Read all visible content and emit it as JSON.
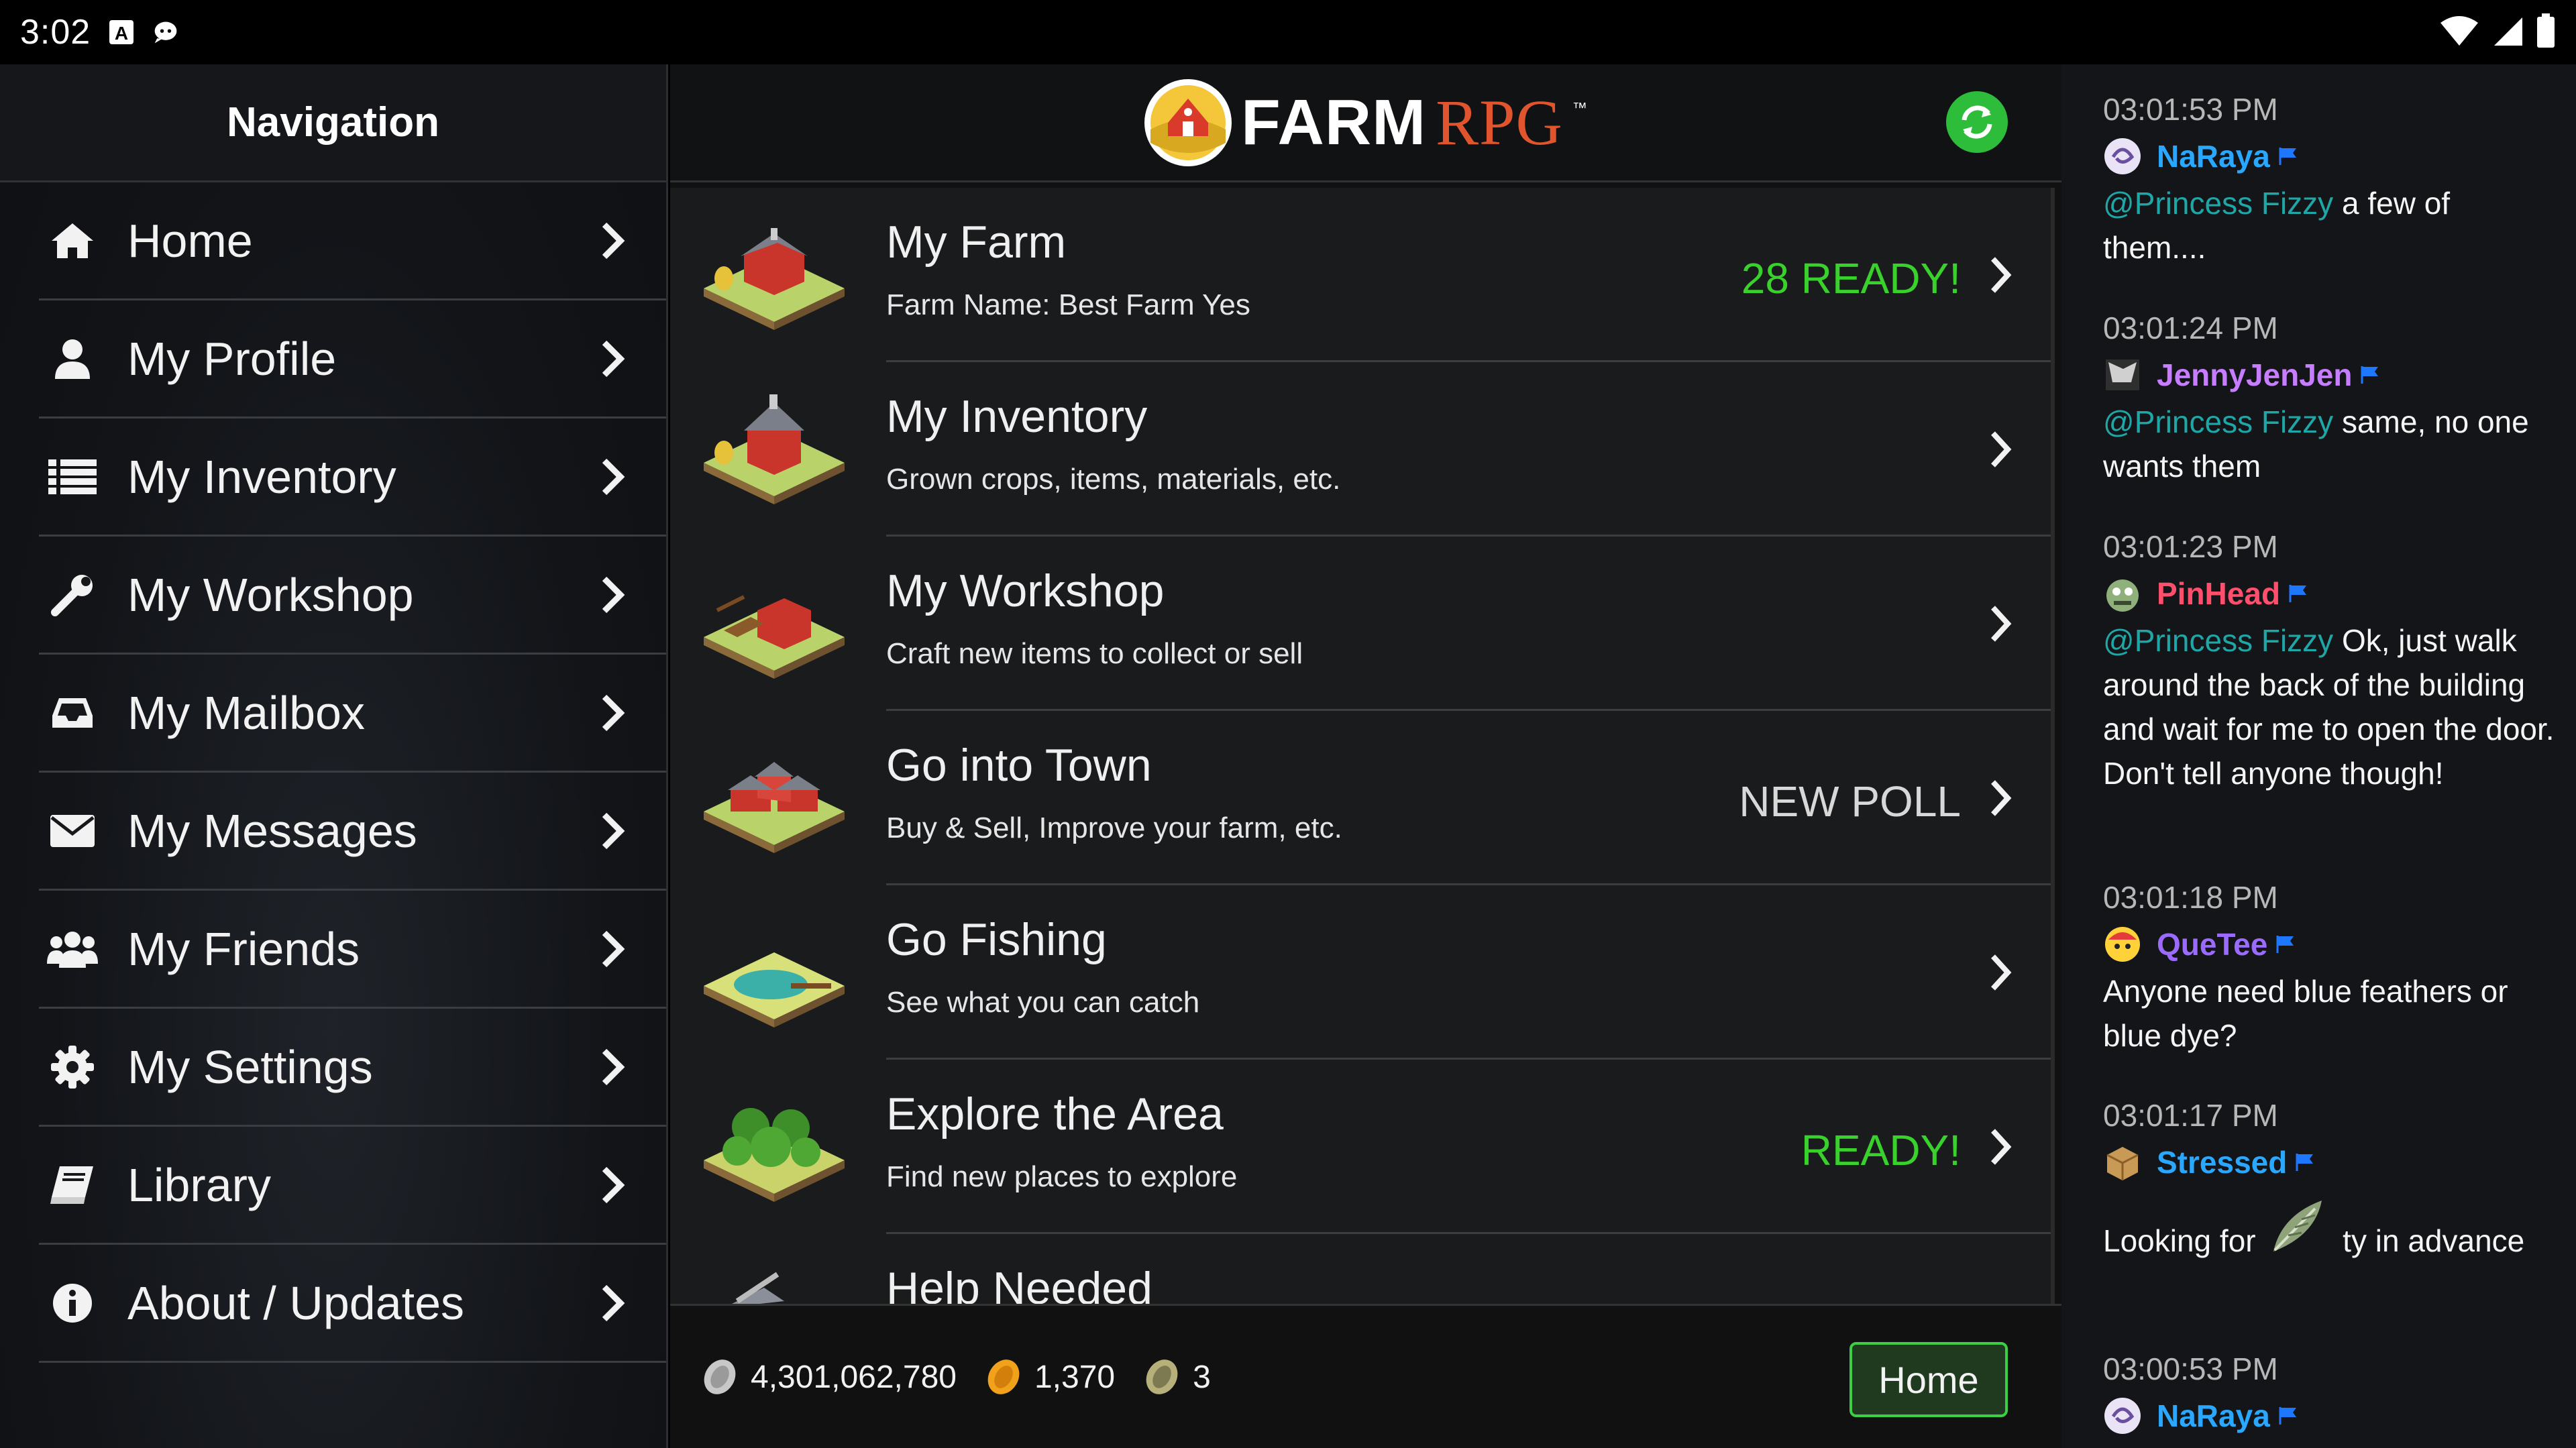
{
  "status_bar": {
    "time": "3:02"
  },
  "nav": {
    "title": "Navigation",
    "items": [
      {
        "label": "Home",
        "icon": "home-icon"
      },
      {
        "label": "My Profile",
        "icon": "user-icon"
      },
      {
        "label": "My Inventory",
        "icon": "list-icon"
      },
      {
        "label": "My Workshop",
        "icon": "wrench-icon"
      },
      {
        "label": "My Mailbox",
        "icon": "inbox-icon"
      },
      {
        "label": "My Messages",
        "icon": "envelope-icon"
      },
      {
        "label": "My Friends",
        "icon": "users-icon"
      },
      {
        "label": "My Settings",
        "icon": "gear-icon"
      },
      {
        "label": "Library",
        "icon": "book-icon"
      },
      {
        "label": "About / Updates",
        "icon": "info-icon"
      }
    ]
  },
  "header": {
    "logo_farm": "FARM",
    "logo_rpg": "RPG",
    "logo_tm": "™"
  },
  "main": {
    "rows": [
      {
        "title": "My Farm",
        "sub": "Farm Name: Best Farm Yes",
        "status": "28 READY!",
        "status_color": "#39d12c"
      },
      {
        "title": "My Inventory",
        "sub": "Grown crops, items, materials, etc.",
        "status": ""
      },
      {
        "title": "My Workshop",
        "sub": "Craft new items to collect or sell",
        "status": ""
      },
      {
        "title": "Go into Town",
        "sub": "Buy & Sell, Improve your farm, etc.",
        "status": "NEW POLL",
        "status_color": "#d8d8d8"
      },
      {
        "title": "Go Fishing",
        "sub": "See what you can catch",
        "status": ""
      },
      {
        "title": "Explore the Area",
        "sub": "Find new places to explore",
        "status": "READY!",
        "status_color": "#39d12c"
      },
      {
        "title": "Help Needed",
        "sub": "",
        "status": ""
      }
    ]
  },
  "footer": {
    "silver": "4,301,062,780",
    "gold": "1,370",
    "ancient": "3",
    "home_label": "Home"
  },
  "chat": {
    "messages": [
      {
        "time": "03:01:53 PM",
        "user": "NaRaya",
        "user_color": "#2aa8ff",
        "mention": "@Princess Fizzy",
        "text": " a few of them...."
      },
      {
        "time": "03:01:24 PM",
        "user": "JennyJenJen",
        "user_color": "#c77dff",
        "mention": "@Princess Fizzy",
        "text": " same, no one wants them"
      },
      {
        "time": "03:01:23 PM",
        "user": "PinHead",
        "user_color": "#ff4f6d",
        "mention": "@Princess Fizzy",
        "text": " Ok, just walk around the back of the building and wait for me to open the door. Don't tell anyone though!"
      },
      {
        "time": "03:01:18 PM",
        "user": "QueTee",
        "user_color": "#9b6bff",
        "mention": "",
        "text": "Anyone need blue feathers or blue dye?"
      },
      {
        "time": "03:01:17 PM",
        "user": "Stressed",
        "user_color": "#2aa8ff",
        "mention": "",
        "text_a": "Looking for ",
        "text_b": " ty in advance"
      },
      {
        "time": "03:00:53 PM",
        "user": "NaRaya",
        "user_color": "#2aa8ff",
        "mention": "",
        "text": ""
      }
    ]
  }
}
